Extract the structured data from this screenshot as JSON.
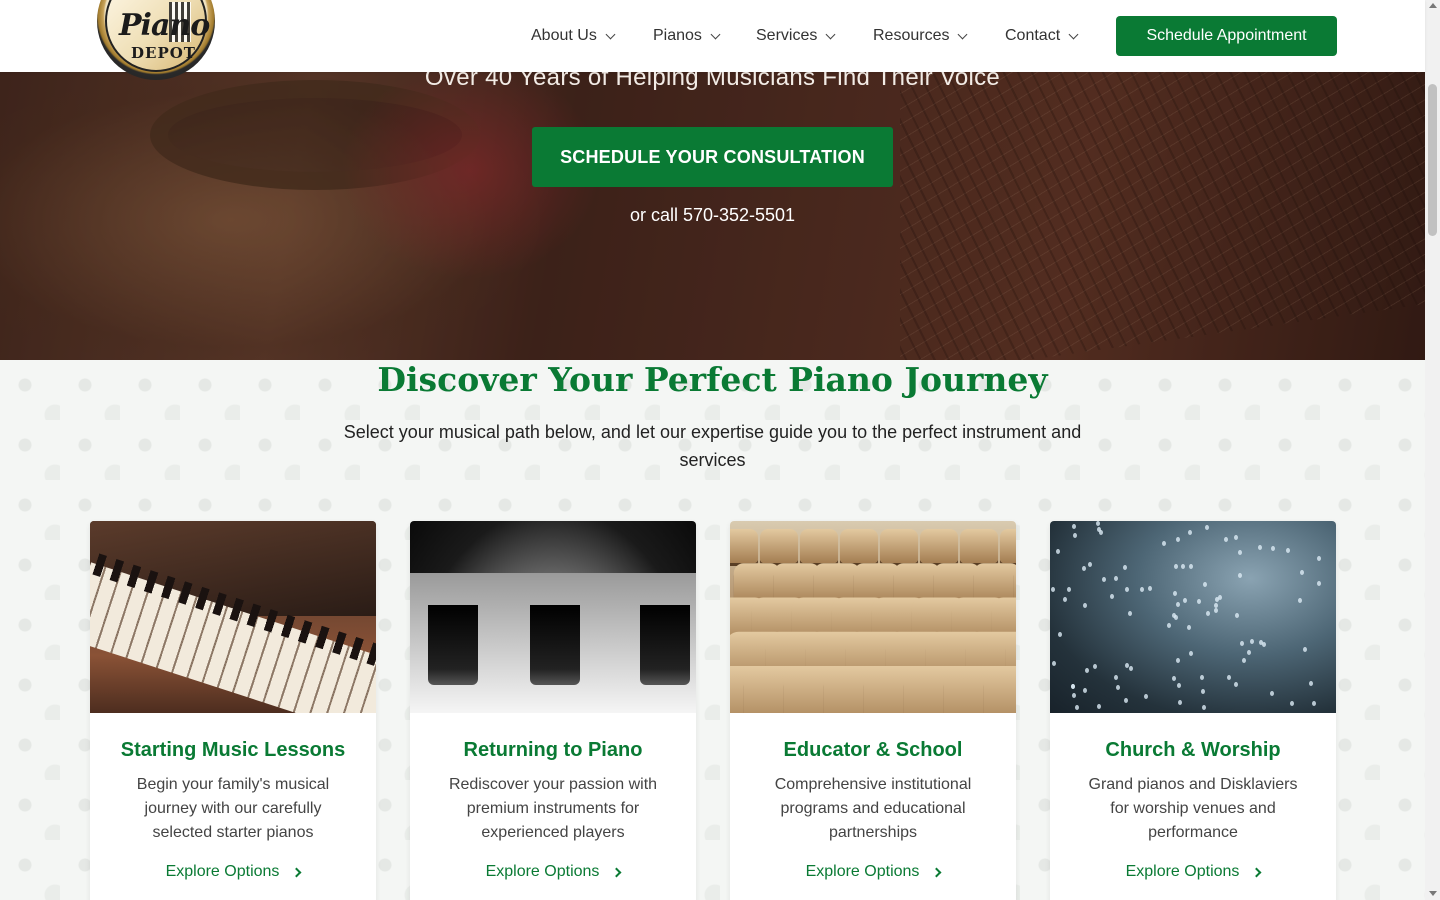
{
  "brand": {
    "logo_line1": "Piano",
    "logo_line2": "DEPOT"
  },
  "nav": {
    "items": [
      {
        "label": "About Us"
      },
      {
        "label": "Pianos"
      },
      {
        "label": "Services"
      },
      {
        "label": "Resources"
      },
      {
        "label": "Contact"
      }
    ],
    "cta": "Schedule Appointment"
  },
  "hero": {
    "tagline": "Over 40 Years of Helping Musicians Find Their Voice",
    "cta": "SCHEDULE YOUR CONSULTATION",
    "call_text": "or call 570-352-5501"
  },
  "section": {
    "title": "Discover Your Perfect Piano Journey",
    "subtitle": "Select your musical path below, and let our expertise guide you to the perfect instrument and services"
  },
  "cards": [
    {
      "title": "Starting Music Lessons",
      "desc": "Begin your family's musical journey with our carefully selected starter pianos",
      "link": "Explore Options",
      "icon": "piano-keys-photo"
    },
    {
      "title": "Returning to Piano",
      "desc": "Rediscover your passion with premium instruments for experienced players",
      "link": "Explore Options",
      "icon": "piano-closeup-photo"
    },
    {
      "title": "Educator & School",
      "desc": "Comprehensive institutional programs and educational partnerships",
      "link": "Explore Options",
      "icon": "auditorium-seats-photo"
    },
    {
      "title": "Church & Worship",
      "desc": "Grand pianos and Disklaviers for worship venues and performance",
      "link": "Explore Options",
      "icon": "rain-window-photo"
    }
  ],
  "colors": {
    "brand_green": "#0a7a34",
    "header_bg": "#ffffff",
    "text_dark": "#333333"
  }
}
